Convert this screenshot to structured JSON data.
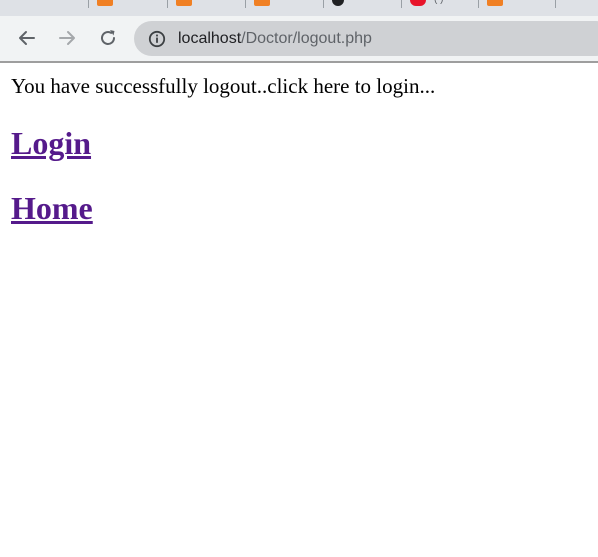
{
  "browser": {
    "address": {
      "host": "localhost",
      "path": "/Doctor/logout.php"
    },
    "tabs": [
      {
        "favicon": "orange-favicon",
        "label": ""
      },
      {
        "favicon": "orange-favicon",
        "label": ""
      },
      {
        "favicon": "orange-favicon",
        "label": ""
      },
      {
        "favicon": "github-favicon",
        "label": ""
      },
      {
        "favicon": "youtube-favicon",
        "label": "( )"
      },
      {
        "favicon": "orange-favicon",
        "label": ""
      }
    ],
    "colors": {
      "chrome_bg": "#f1f3f4",
      "omnibox_bg": "#cfd1d4",
      "link_visited": "#551a8b"
    }
  },
  "page": {
    "message": "You have successfully logout..click here to login...",
    "login_link": "Login",
    "home_link": "Home"
  }
}
